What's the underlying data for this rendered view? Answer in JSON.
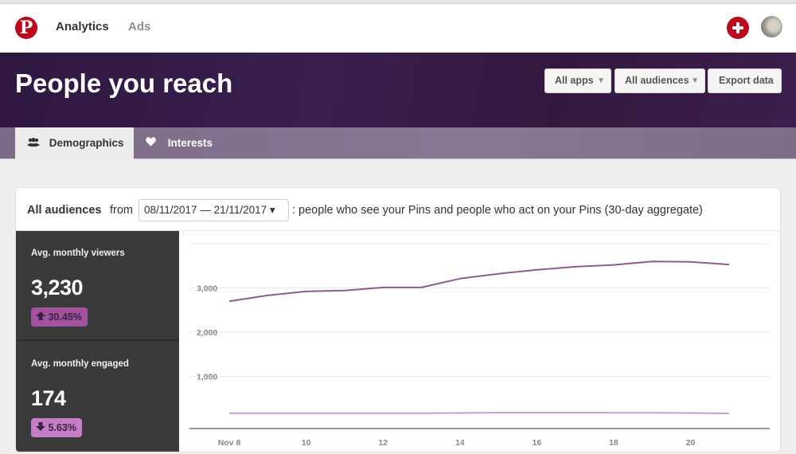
{
  "nav": {
    "logo": "P",
    "links": [
      {
        "label": "Analytics",
        "active": true
      },
      {
        "label": "Ads",
        "active": false
      }
    ],
    "icons": [
      "pinterest-logo-icon",
      "add-plus-icon",
      "user-avatar"
    ]
  },
  "hero": {
    "title": "People you reach",
    "buttons": {
      "apps": "All apps",
      "audiences": "All audiences",
      "export": "Export data"
    },
    "caret": "▼"
  },
  "tabs": [
    {
      "label": "Demographics",
      "icon": "people-icon",
      "glyph": "👥",
      "active": true
    },
    {
      "label": "Interests",
      "icon": "heart-icon",
      "glyph": "♥",
      "active": false
    }
  ],
  "card": {
    "audience": "All audiences",
    "from": "from",
    "date_range": "08/11/2017 — 21/11/2017 ▾",
    "description": ": people who see your Pins and people who act on your Pins (30-day aggregate)"
  },
  "stats": [
    {
      "label": "Avg. monthly viewers",
      "value": "3,230",
      "change": "30.45%",
      "direction": "up",
      "arrow": "🡅"
    },
    {
      "label": "Avg. monthly engaged",
      "value": "174",
      "change": "5.63%",
      "direction": "down",
      "arrow": "🡇"
    }
  ],
  "colors": {
    "brand_red": "#bd081c",
    "hero_purple": "#341a45",
    "viewers_line": "#8f5a92",
    "engaged_line": "#c99ad0",
    "badge_up": "#a2529f",
    "badge_down": "#c57dc7"
  },
  "chart_data": {
    "type": "line",
    "title": "",
    "xlabel": "",
    "ylabel": "",
    "x": [
      8,
      9,
      10,
      11,
      12,
      13,
      14,
      15,
      16,
      17,
      18,
      19,
      20,
      21
    ],
    "x_ticks": [
      8,
      10,
      12,
      14,
      16,
      18,
      20
    ],
    "x_tick_labels": [
      "Nov 8",
      "10",
      "12",
      "14",
      "16",
      "18",
      "20"
    ],
    "y_ticks": [
      1000,
      2000,
      3000,
      4000
    ],
    "y_tick_labels": [
      "1,000",
      "2,000",
      "3,000",
      ""
    ],
    "ylim": [
      0,
      4000
    ],
    "grid": true,
    "legend": "none",
    "series": [
      {
        "name": "Avg. monthly viewers",
        "values": [
          2700,
          2830,
          2920,
          2940,
          3010,
          3010,
          3210,
          3320,
          3410,
          3480,
          3520,
          3600,
          3590,
          3530
        ]
      },
      {
        "name": "Avg. monthly engaged",
        "values": [
          165,
          165,
          165,
          166,
          166,
          167,
          172,
          178,
          178,
          178,
          176,
          176,
          172,
          160
        ]
      }
    ]
  }
}
